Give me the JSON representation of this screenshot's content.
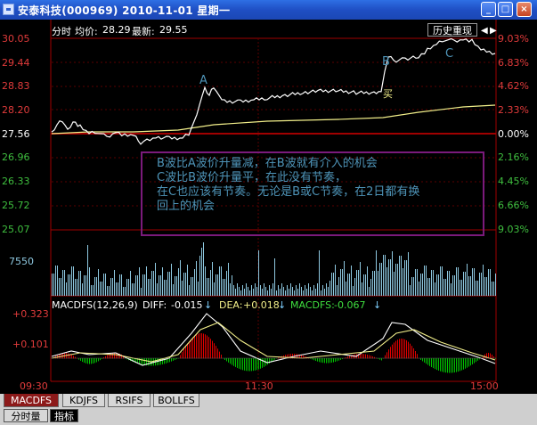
{
  "window": {
    "title": "安泰科技(000969)  2010-11-01  星期一",
    "buttons": [
      "_",
      "□",
      "×"
    ]
  },
  "header": {
    "mode": "分时",
    "avg_label": "均价:",
    "avg_value": "28.29",
    "latest_label": "最新:",
    "latest_value": "29.55",
    "history_button": "历史重现"
  },
  "price_axis": {
    "left": [
      "30.05",
      "29.44",
      "28.83",
      "28.20",
      "27.56",
      "26.96",
      "26.33",
      "25.72",
      "25.07"
    ],
    "right": [
      "9.03%",
      "6.83%",
      "4.62%",
      "2.33%",
      "0.00%",
      "2.16%",
      "4.45%",
      "6.66%",
      "9.03%"
    ]
  },
  "volume_axis": {
    "left": [
      "7550"
    ]
  },
  "macd": {
    "title": "MACDFS(12,26,9)",
    "diff_label": "DIFF:",
    "diff_value": "-0.015",
    "dea_label": "DEA:",
    "dea_value": "+0.018",
    "macdfs_label": "MACDFS:",
    "macdfs_value": "-0.067",
    "axis": [
      "+0.323",
      "+0.101"
    ]
  },
  "time_axis": [
    "09:30",
    "11:30",
    "15:00"
  ],
  "chart_labels": {
    "A": "A",
    "B": "B",
    "C": "C",
    "buy": "买"
  },
  "annotation": [
    "B波比A波价升量减，在B波就有介入的机会",
    "C波比B波价升量平，在此没有节奏，",
    "在C也应该有节奏。无论是B或C节奏，在2日都有换",
    "回上的机会"
  ],
  "indicator_tabs": [
    "MACDFS",
    "KDJFS",
    "RSIFS",
    "BOLLFS"
  ],
  "view_tabs": [
    "分时量",
    "指标"
  ],
  "colors": {
    "up": "#e00000",
    "down": "#00c000",
    "axis_up": "#e23b3b",
    "axis_down": "#3fbf3f",
    "price_line": "#ffffff",
    "avg_line": "#f2ef8a",
    "volume": "#8ec8e0",
    "annotation_text": "#4e94b8",
    "annotation_border": "#7b1a7b"
  }
}
